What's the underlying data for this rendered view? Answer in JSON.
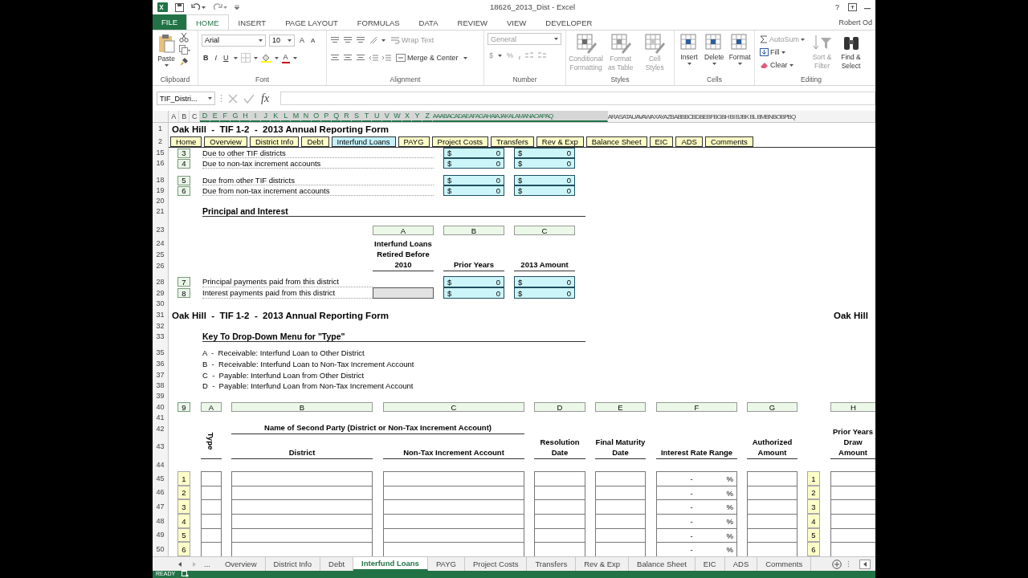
{
  "window": {
    "title": "18626_2013_Dist - Excel",
    "help": "?"
  },
  "file_tab": "FILE",
  "tabs": [
    {
      "label": "HOME",
      "selected": true
    },
    {
      "label": "INSERT",
      "selected": false
    },
    {
      "label": "PAGE LAYOUT",
      "selected": false
    },
    {
      "label": "FORMULAS",
      "selected": false
    },
    {
      "label": "DATA",
      "selected": false
    },
    {
      "label": "REVIEW",
      "selected": false
    },
    {
      "label": "VIEW",
      "selected": false
    },
    {
      "label": "DEVELOPER",
      "selected": false
    }
  ],
  "user": "Robert Od",
  "clipboard": {
    "group": "Clipboard",
    "paste": "Paste"
  },
  "font": {
    "group": "Font",
    "name": "Arial",
    "size": "10",
    "grow": "A",
    "shrink": "A",
    "bold": "B",
    "italic": "I",
    "underline": "U",
    "foreground": "A"
  },
  "alignment": {
    "group": "Alignment",
    "wrap": "Wrap Text",
    "merge": "Merge & Center"
  },
  "number": {
    "group": "Number",
    "format": "General",
    "currency": "$",
    "percent": "%"
  },
  "styles": {
    "group": "Styles",
    "buttons": [
      {
        "label": "Conditional Formatting",
        "disabled": true
      },
      {
        "label": "Format as Table",
        "disabled": true
      },
      {
        "label": "Cell Styles",
        "disabled": true
      }
    ]
  },
  "cells": {
    "group": "Cells",
    "buttons": [
      "Insert",
      "Delete",
      "Format"
    ]
  },
  "editing": {
    "group": "Editing",
    "items": [
      "AutoSum",
      "Fill",
      "Clear"
    ],
    "buttons": [
      {
        "label": "Sort & Filter",
        "disabled": true
      },
      {
        "label": "Find & Select",
        "disabled": false
      }
    ]
  },
  "formula_bar": {
    "name_box": "TIF_Distri...",
    "function_label": "fx"
  },
  "column_headers": [
    {
      "label": "A",
      "selected": false
    },
    {
      "label": "B",
      "selected": false
    },
    {
      "label": "C",
      "selected": false
    },
    {
      "label": "D",
      "selected": true
    },
    {
      "label": "E",
      "selected": true
    },
    {
      "label": "F",
      "selected": true
    },
    {
      "label": "G",
      "selected": true
    },
    {
      "label": "H",
      "selected": true
    },
    {
      "label": "I",
      "selected": true
    },
    {
      "label": "J",
      "selected": true
    },
    {
      "label": "K",
      "selected": true
    },
    {
      "label": "L",
      "selected": true
    },
    {
      "label": "M",
      "selected": true
    },
    {
      "label": "N",
      "selected": true
    },
    {
      "label": "O",
      "selected": true
    },
    {
      "label": "P",
      "selected": true
    },
    {
      "label": "Q",
      "selected": true
    },
    {
      "label": "R",
      "selected": true
    },
    {
      "label": "S",
      "selected": true
    },
    {
      "label": "T",
      "selected": true
    },
    {
      "label": "U",
      "selected": true
    },
    {
      "label": "V",
      "selected": true
    },
    {
      "label": "W",
      "selected": true
    },
    {
      "label": "X",
      "selected": true
    },
    {
      "label": "Y",
      "selected": true
    },
    {
      "label": "Z",
      "selected": true
    },
    {
      "label": "AAABACADAEAFAGAHAIAJAKALAMANAOAPAQ",
      "selected": true
    },
    {
      "label": "ARASATAUAVAWAXAYAZBABBBCBDBEBFBGBH BI BJBK BL BMBNBOBPBQ",
      "selected": false
    }
  ],
  "sheet": {
    "row_numbers": [
      "1",
      "2",
      "15",
      "16",
      "18",
      "19",
      "20",
      "21",
      "23",
      "24",
      "25",
      "26",
      "28",
      "29",
      "30",
      "31",
      "32",
      "33",
      "35",
      "36",
      "37",
      "38",
      "39",
      "40",
      "41",
      "42",
      "43",
      "44",
      "45",
      "46",
      "47",
      "48",
      "49",
      "50"
    ],
    "title": "Oak Hill  -  TIF 1-2  -  2013 Annual Reporting Form",
    "nav_buttons": [
      {
        "label": "Home",
        "selected": false
      },
      {
        "label": "Overview",
        "selected": false
      },
      {
        "label": "District Info",
        "selected": false
      },
      {
        "label": "Debt",
        "selected": false
      },
      {
        "label": "Interfund Loans",
        "selected": true
      },
      {
        "label": "PAYG",
        "selected": false
      },
      {
        "label": "Project Costs",
        "selected": false
      },
      {
        "label": "Transfers",
        "selected": false
      },
      {
        "label": "Rev & Exp",
        "selected": false
      },
      {
        "label": "Balance Sheet",
        "selected": false
      },
      {
        "label": "EIC",
        "selected": false
      },
      {
        "label": "ADS",
        "selected": false
      },
      {
        "label": "Comments",
        "selected": false
      }
    ],
    "balances": [
      {
        "line": "3",
        "label": "Due to other TIF districts",
        "prior": {
          "currency": "$",
          "value": "0"
        },
        "current": {
          "currency": "$",
          "value": "0"
        }
      },
      {
        "line": "4",
        "label": "Due to non-tax increment accounts",
        "prior": {
          "currency": "$",
          "value": "0"
        },
        "current": {
          "currency": "$",
          "value": "0"
        }
      },
      {
        "line": "5",
        "label": "Due from other TIF districts",
        "prior": {
          "currency": "$",
          "value": "0"
        },
        "current": {
          "currency": "$",
          "value": "0"
        }
      },
      {
        "line": "6",
        "label": "Due from non-tax increment accounts",
        "prior": {
          "currency": "$",
          "value": "0"
        },
        "current": {
          "currency": "$",
          "value": "0"
        }
      }
    ],
    "principal": {
      "heading": "Principal and Interest",
      "letters": [
        "A",
        "B",
        "C"
      ],
      "headings": [
        "Interfund Loans Retired Before 2010",
        "Prior Years",
        "2013 Amount"
      ],
      "lines": [
        {
          "line": "7",
          "label": "Principal payments paid from this district",
          "locked": false,
          "prior": {
            "currency": "$",
            "value": "0"
          },
          "current": {
            "currency": "$",
            "value": "0"
          }
        },
        {
          "line": "8",
          "label": "Interest payments paid from this district",
          "locked": true,
          "prior": {
            "currency": "$",
            "value": "0"
          },
          "current": {
            "currency": "$",
            "value": "0"
          }
        }
      ]
    },
    "title_repeat": "Oak Hill  -  TIF 1-2  -  2013 Annual Reporting Form",
    "title_right": "Oak Hill",
    "key": {
      "heading": "Key To Drop-Down Menu for \"Type\"",
      "items": [
        "A  -  Receivable: Interfund Loan to Other District",
        "B  -  Receivable: Interfund Loan to Non-Tax Increment Account",
        "C  -  Payable: Interfund Loan from Other District",
        "D  -  Payable: Interfund Loan from Non-Tax Increment Account"
      ]
    },
    "loans": {
      "line": "9",
      "letters": [
        "A",
        "B",
        "C",
        "D",
        "E",
        "F",
        "G",
        "H"
      ],
      "group_heading": "Name of Second Party (District or Non-Tax Increment Account)",
      "headings": [
        "Type",
        "District",
        "Non-Tax Increment Account",
        "Resolution Date",
        "Final Maturity Date",
        "Interest Rate Range",
        "Authorized Amount",
        "Prior Years Draw Amount"
      ],
      "rows": [
        {
          "number": "1",
          "rate": "-",
          "unit": "%",
          "right_number": "1"
        },
        {
          "number": "2",
          "rate": "-",
          "unit": "%",
          "right_number": "2"
        },
        {
          "number": "3",
          "rate": "-",
          "unit": "%",
          "right_number": "3"
        },
        {
          "number": "4",
          "rate": "-",
          "unit": "%",
          "right_number": "4"
        },
        {
          "number": "5",
          "rate": "-",
          "unit": "%",
          "right_number": "5"
        },
        {
          "number": "6",
          "rate": "-",
          "unit": "%",
          "right_number": "6"
        }
      ]
    }
  },
  "sheet_tabs": {
    "more": "...",
    "tabs": [
      {
        "label": "Overview",
        "selected": false
      },
      {
        "label": "District Info",
        "selected": false
      },
      {
        "label": "Debt",
        "selected": false
      },
      {
        "label": "Interfund Loans",
        "selected": true
      },
      {
        "label": "PAYG",
        "selected": false
      },
      {
        "label": "Project Costs",
        "selected": false
      },
      {
        "label": "Transfers",
        "selected": false
      },
      {
        "label": "Rev & Exp",
        "selected": false
      },
      {
        "label": "Balance Sheet",
        "selected": false
      },
      {
        "label": "EIC",
        "selected": false
      },
      {
        "label": "ADS",
        "selected": false
      },
      {
        "label": "Comments",
        "selected": false
      }
    ]
  },
  "status_bar": {
    "mode": "READY"
  }
}
